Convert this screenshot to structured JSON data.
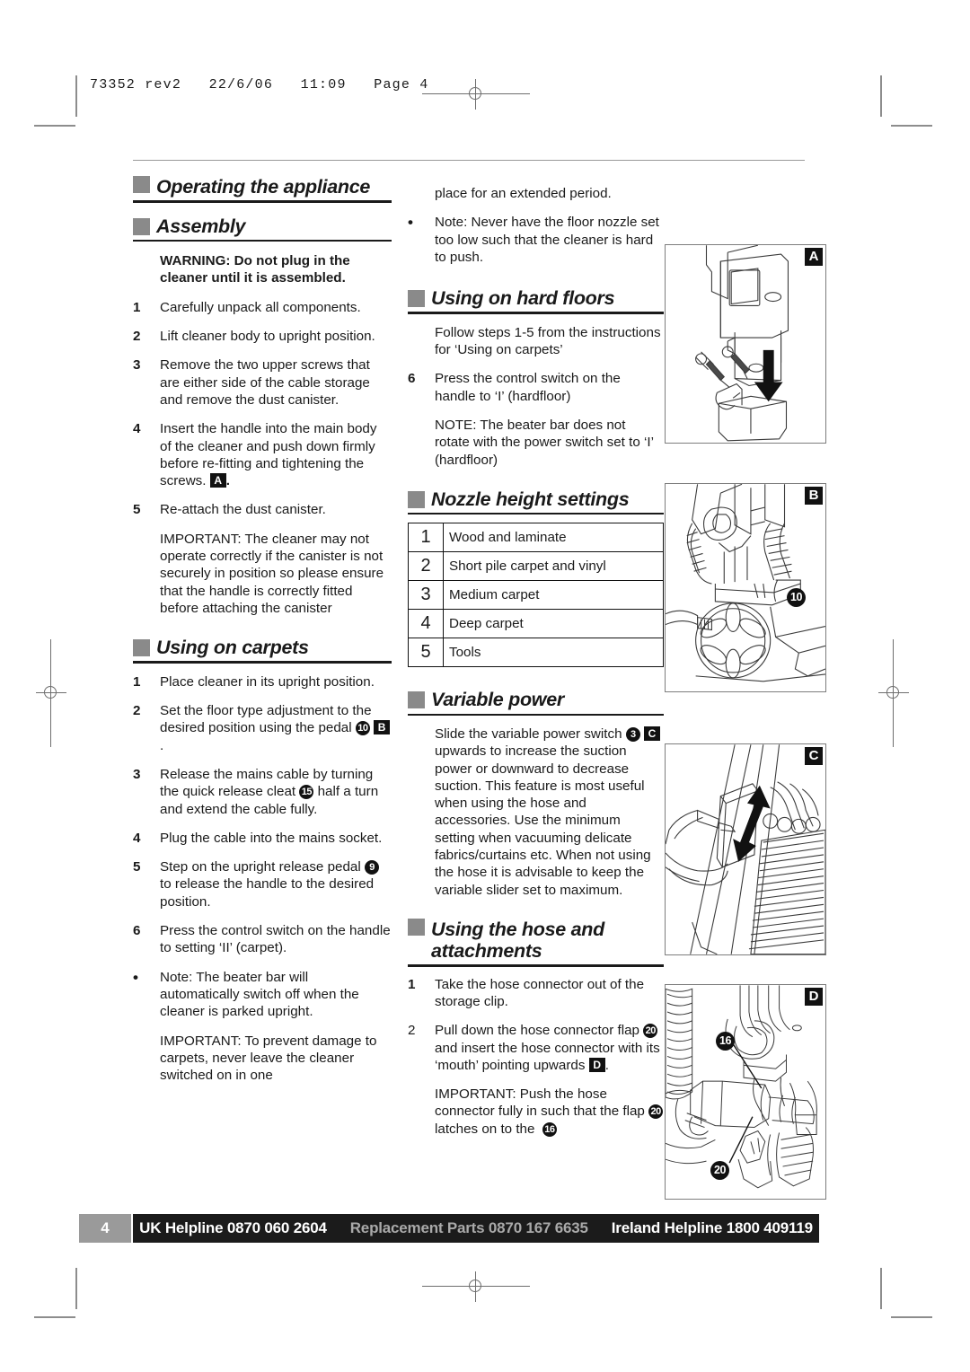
{
  "file_header": "73352 rev2   22/6/06   11:09   Page 4",
  "columns": {
    "left": {
      "heading_operating": "Operating the appliance",
      "heading_assembly": "Assembly",
      "warning": "WARNING: Do not plug in the cleaner until it is assembled.",
      "assembly_steps": [
        {
          "num": "1",
          "text": "Carefully unpack all components."
        },
        {
          "num": "2",
          "text": "Lift cleaner body to upright position."
        },
        {
          "num": "3",
          "text": "Remove the two upper screws that are either side of the cable storage and remove the dust canister."
        },
        {
          "num": "4",
          "text": "Insert the handle into the main body of the cleaner and push down firmly before re-fitting and tightening the screws.",
          "badge_sq": "A",
          "suffix": "."
        },
        {
          "num": "5",
          "text": "Re-attach the dust canister."
        }
      ],
      "assembly_important": "IMPORTANT: The cleaner may not operate correctly if the canister is not securely in position so please ensure that the handle is correctly fitted before attaching the canister",
      "heading_carpets": "Using on carpets",
      "carpet_steps": [
        {
          "num": "1",
          "text": "Place cleaner in its upright position."
        },
        {
          "num": "2",
          "text_a": "Set the floor type adjustment to the desired position using the pedal",
          "badge_circ": "10",
          "badge_sq": "B",
          "suffix": "."
        },
        {
          "num": "3",
          "text_a": "Release the mains cable by turning the quick release cleat",
          "badge_circ": "15",
          "text_b": "half a turn and extend the cable fully."
        },
        {
          "num": "4",
          "text": "Plug the cable into the mains socket."
        },
        {
          "num": "5",
          "text_a": "Step on the upright release pedal",
          "badge_circ": "9",
          "text_b": "to release the handle to the desired position."
        },
        {
          "num": "6",
          "text": "Press the control switch on the handle to setting ‘II’ (carpet)."
        },
        {
          "num": "•",
          "text": "Note: The beater bar will automatically switch off when the cleaner is parked upright."
        }
      ],
      "carpet_important": "IMPORTANT: To prevent damage to carpets, never leave the cleaner switched on in one"
    },
    "middle": {
      "continuation": "place for an extended period.",
      "note_nozzle": {
        "num": "•",
        "text": "Note: Never have the floor nozzle set too low such that the cleaner is hard to push."
      },
      "heading_hard_floors": "Using on hard floors",
      "hard_floor_intro": "Follow steps 1-5 from the instructions for ‘Using on carpets’",
      "hard_floor_step": {
        "num": "6",
        "text": "Press the control switch on the handle to ‘I’ (hardfloor)"
      },
      "hard_floor_note": "NOTE: The beater bar does not rotate with the power switch set to ‘I’ (hardfloor)",
      "heading_nozzle_settings": "Nozzle height settings",
      "nozzle_table": [
        {
          "n": "1",
          "desc": "Wood and laminate"
        },
        {
          "n": "2",
          "desc": "Short pile carpet and vinyl"
        },
        {
          "n": "3",
          "desc": "Medium carpet"
        },
        {
          "n": "4",
          "desc": "Deep carpet"
        },
        {
          "n": "5",
          "desc": "Tools"
        }
      ],
      "heading_variable_power": "Variable power",
      "variable_power": {
        "text_a": "Slide the variable power switch",
        "badge_circ": "3",
        "badge_sq": "C",
        "text_b": "upwards to increase the suction power or downward to decrease suction. This feature is most useful when using the hose and accessories. Use the minimum setting when vacuuming delicate fabrics/curtains etc. When not using the hose it is advisable to keep the variable slider set to maximum."
      },
      "heading_hose": "Using the hose and attachments",
      "hose_steps": [
        {
          "num": "1",
          "text": "Take the hose connector out of the storage clip."
        },
        {
          "num": "2",
          "text_a": "Pull down the hose connector flap",
          "badge_circ": "20",
          "text_b": "and insert the hose connector with its ‘mouth’ pointing upwards",
          "badge_sq": "D",
          "suffix": "."
        }
      ],
      "hose_important": {
        "text_a": "IMPORTANT: Push the hose connector fully in such that the flap",
        "badge_circ_1": "20",
        "text_b": "latches on to the",
        "badge_circ_2": "16"
      }
    },
    "figures": [
      {
        "letter": "A",
        "caption_badges": []
      },
      {
        "letter": "B",
        "caption_badges": [
          "10"
        ]
      },
      {
        "letter": "C",
        "caption_badges": []
      },
      {
        "letter": "D",
        "caption_badges": [
          "16",
          "20"
        ]
      }
    ]
  },
  "footer": {
    "page_number": "4",
    "uk_helpline": "UK Helpline 0870 060 2604",
    "replacement_parts": "Replacement Parts 0870 167 6635",
    "ireland_helpline": "Ireland Helpline 1800 409119"
  },
  "colors": {
    "heading_square": "#8a8a8a",
    "badge_bg": "#111111",
    "footer_bar": "#1b1b1b",
    "page_num_bg": "#9a9a9a",
    "replacement_parts_text": "#a9a9a9"
  }
}
